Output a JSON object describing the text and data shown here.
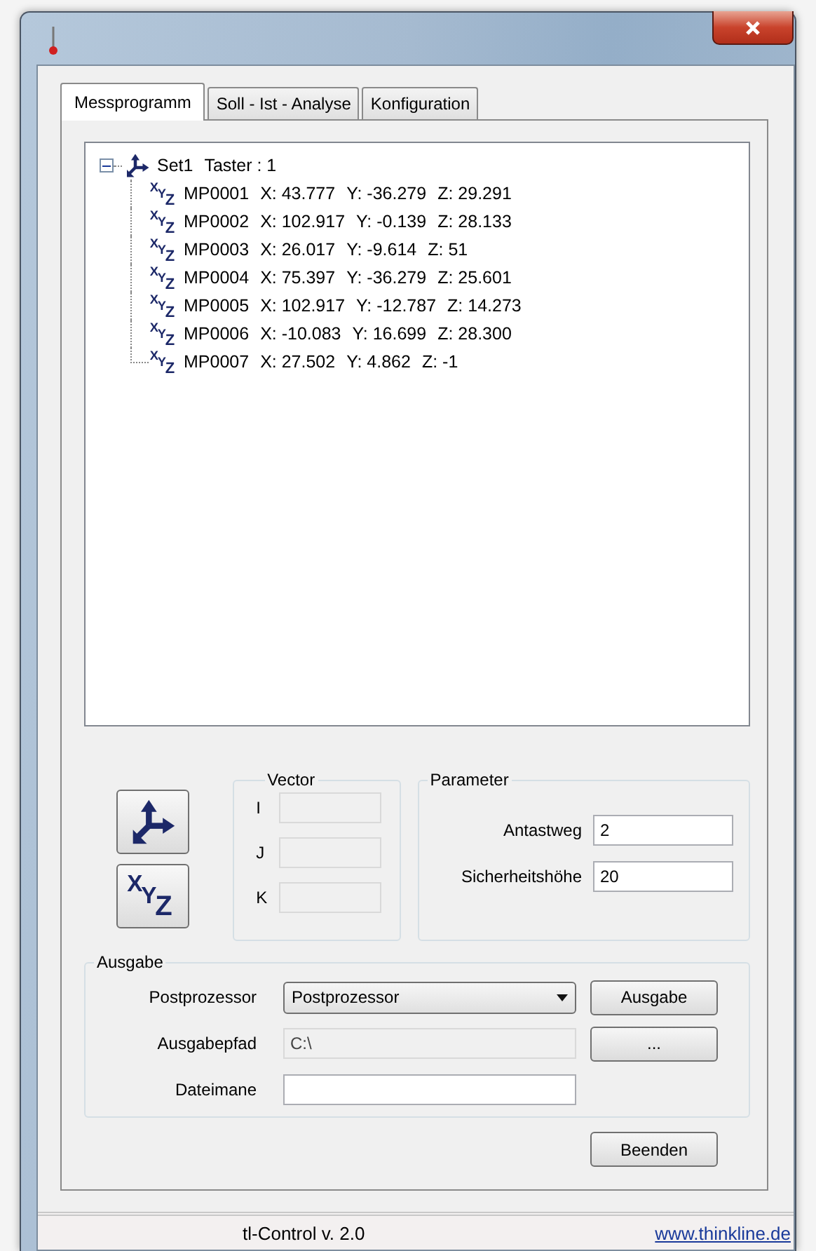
{
  "tabs": [
    {
      "label": "Messprogramm",
      "selected": true
    },
    {
      "label": "Soll - Ist - Analyse",
      "selected": false
    },
    {
      "label": "Konfiguration",
      "selected": false
    }
  ],
  "tree": [
    {
      "label": "Set1",
      "detail": "Taster : 1",
      "expanded": true,
      "children": [
        {
          "glyphs": "XYZ",
          "label": "MP0001",
          "coords": [
            "X: 43.777",
            "Y: -36.279",
            "Z: 29.291"
          ]
        },
        {
          "glyphs": "XYZ",
          "label": "MP0002",
          "coords": [
            "X: 102.917",
            "Y: -0.139",
            "Z: 28.133"
          ]
        },
        {
          "glyphs": "XYZ",
          "label": "MP0003",
          "coords": [
            "X: 26.017",
            "Y: -9.614",
            "Z: 51"
          ]
        },
        {
          "glyphs": "XYZ",
          "label": "MP0004",
          "coords": [
            "X: 75.397",
            "Y: -36.279",
            "Z: 25.601"
          ]
        },
        {
          "glyphs": "XYZ",
          "label": "MP0005",
          "coords": [
            "X: 102.917",
            "Y: -12.787",
            "Z: 14.273"
          ]
        },
        {
          "glyphs": "XYZ",
          "label": "MP0006",
          "coords": [
            "X: -10.083",
            "Y: 16.699",
            "Z: 28.300"
          ]
        },
        {
          "glyphs": "XYZ",
          "label": "MP0007",
          "coords": [
            "X: 27.502",
            "Y: 4.862",
            "Z: -1"
          ]
        }
      ]
    }
  ],
  "tool_buttons": [
    {
      "kind": "axes"
    },
    {
      "kind": "xyz",
      "glyphs": "XYZ"
    }
  ],
  "vector": {
    "title": "Vector",
    "fields": [
      {
        "label": "I",
        "disabled": true
      },
      {
        "label": "J",
        "disabled": true
      },
      {
        "label": "K",
        "disabled": true
      }
    ]
  },
  "parameter": {
    "title": "Parameter",
    "fields": [
      {
        "label": "Antastweg",
        "value": "2"
      },
      {
        "label": "Sicherheitshöhe",
        "value": "20"
      }
    ]
  },
  "ausgabe": {
    "title": "Ausgabe",
    "rows": [
      {
        "kind": "dropdown",
        "label": "Postprozessor",
        "value": "Postprozessor",
        "disabled": false,
        "button": "Ausgabe"
      },
      {
        "kind": "text",
        "label": "Ausgabepfad",
        "value": "C:\\",
        "disabled": true,
        "button": "..."
      },
      {
        "kind": "text",
        "label": "Dateimane",
        "disabled": false
      }
    ]
  },
  "close_button": "Beenden",
  "status_bar": {
    "title": "tl-Control v. 2.0",
    "link": "www.thinkline.de"
  }
}
